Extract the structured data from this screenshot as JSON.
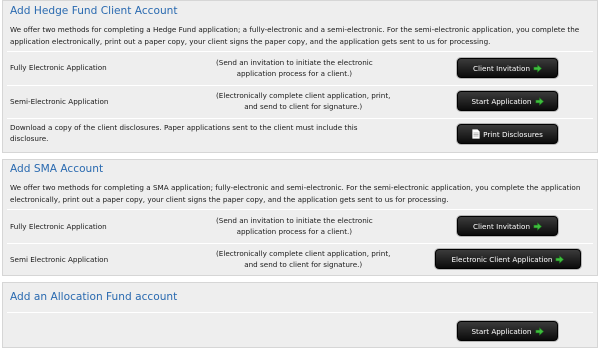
{
  "hedge": {
    "title": "Add Hedge Fund Client Account",
    "intro": "We offer two methods for completing a Hedge Fund application; a fully-electronic and a semi-electronic. For the semi-electronic application, you complete the application electronically, print out a paper copy, your client signs the paper copy, and the application gets sent to us for processing.",
    "rows": [
      {
        "label": "Fully Electronic Application",
        "desc1": "(Send an invitation to initiate the electronic",
        "desc2": "application process for a client.)",
        "button": "Client Invitation"
      },
      {
        "label": "Semi-Electronic Application",
        "desc1": "(Electronically complete client application, print,",
        "desc2": "and send to client for signature.)",
        "button": "Start Application"
      }
    ],
    "disclosure": {
      "label": "Download a copy of the client disclosures. Paper applications sent to the client must include this disclosure.",
      "button": "Print Disclosures"
    }
  },
  "sma": {
    "title": "Add SMA Account",
    "intro": "We offer two methods for completing a SMA application; fully-electronic and semi-electronic. For the semi-electronic application, you complete the application electronically, print out a paper copy, your client signs the paper copy, and the application gets sent to us for processing.",
    "rows": [
      {
        "label": "Fully Electronic Application",
        "desc1": "(Send an invitation to initiate the electronic",
        "desc2": "application process for a client.)",
        "button": "Client Invitation"
      },
      {
        "label": "Semi Electronic Application",
        "desc1": "(Electronically complete client application, print,",
        "desc2": "and send to client for signature.)",
        "button": "Electronic Client Application"
      }
    ]
  },
  "allocation": {
    "title": "Add an Allocation Fund account",
    "button": "Start Application"
  },
  "icons": {
    "arrow": "arrow-right-icon",
    "document": "document-icon"
  },
  "colors": {
    "title": "#2a6ab0",
    "panel": "#eeeeee",
    "button": "#1a1a1a",
    "arrow": "#3fbf3f"
  }
}
